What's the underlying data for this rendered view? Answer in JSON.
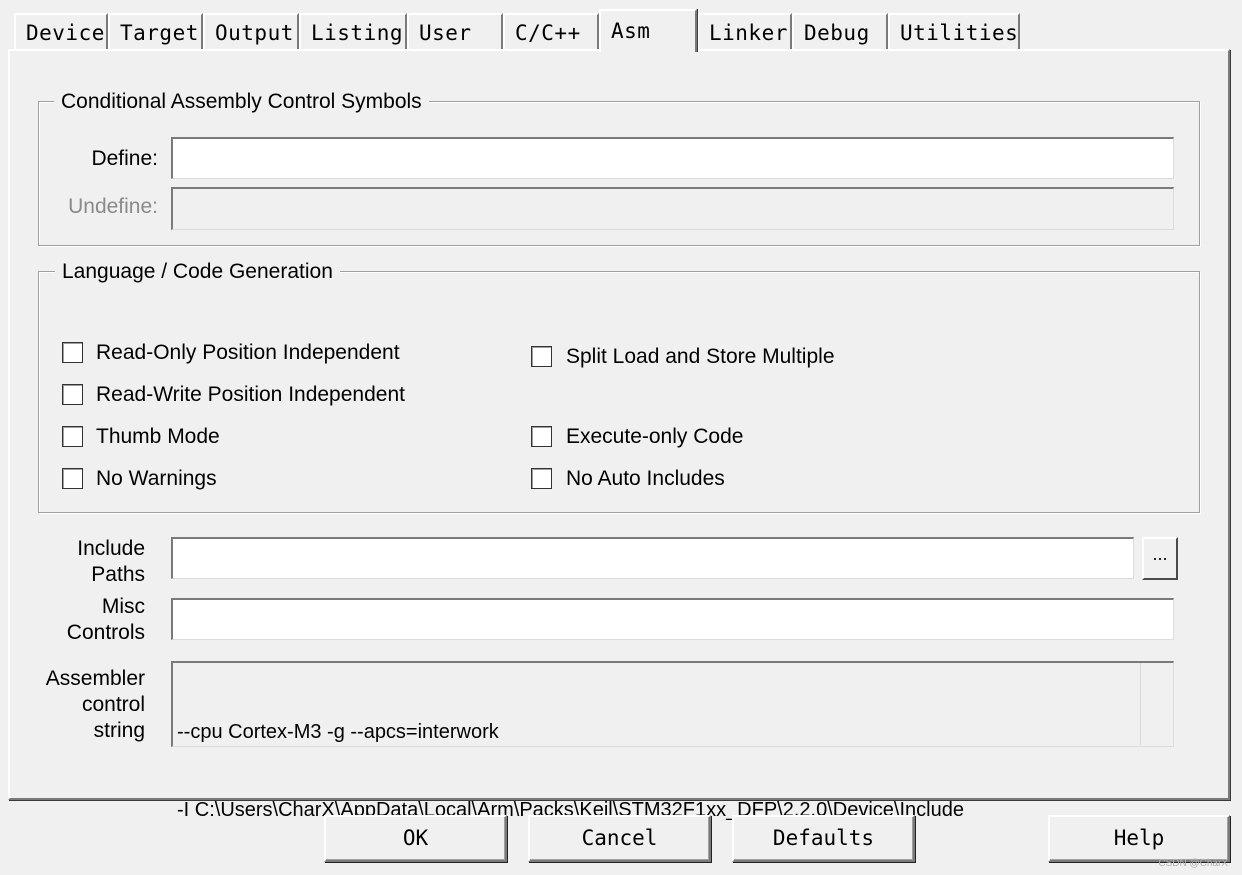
{
  "tabs": [
    {
      "label": "Device"
    },
    {
      "label": "Target"
    },
    {
      "label": "Output"
    },
    {
      "label": "Listing"
    },
    {
      "label": "User"
    },
    {
      "label": "C/C++"
    },
    {
      "label": "Asm",
      "active": true
    },
    {
      "label": "Linker"
    },
    {
      "label": "Debug"
    },
    {
      "label": "Utilities"
    }
  ],
  "conditional": {
    "title": "Conditional Assembly Control Symbols",
    "define_label": "Define:",
    "define_value": "",
    "undefine_label": "Undefine:",
    "undefine_value": ""
  },
  "language": {
    "title": "Language / Code Generation",
    "read_only_pi": "Read-Only Position Independent",
    "read_write_pi": "Read-Write Position Independent",
    "thumb_mode": "Thumb Mode",
    "no_warnings": "No Warnings",
    "split_load_store": "Split Load and Store Multiple",
    "execute_only": "Execute-only Code",
    "no_auto_includes": "No Auto Includes"
  },
  "include_paths": {
    "label_line1": "Include",
    "label_line2": "Paths",
    "value": "",
    "browse_label": "..."
  },
  "misc_controls": {
    "label_line1": "Misc",
    "label_line2": "Controls",
    "value": ""
  },
  "assembler_control": {
    "label_line1": "Assembler",
    "label_line2": "control",
    "label_line3": "string",
    "line1": "--cpu Cortex-M3 -g --apcs=interwork",
    "line2": "-I C:\\Users\\CharX\\AppData\\Local\\Arm\\Packs\\Keil\\STM32F1xx_DFP\\2.2.0\\Device\\Include"
  },
  "buttons": {
    "ok": "OK",
    "cancel": "Cancel",
    "defaults": "Defaults",
    "help": "Help"
  },
  "watermark": "CSDN @CharX"
}
